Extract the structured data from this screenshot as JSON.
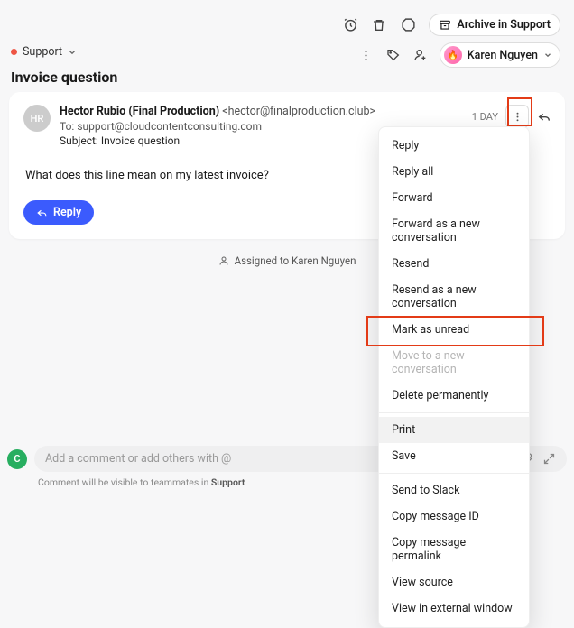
{
  "toolbar": {
    "archive_label": "Archive in Support"
  },
  "breadcrumb": {
    "label": "Support"
  },
  "user": {
    "name": "Karen Nguyen"
  },
  "thread": {
    "title": "Invoice question"
  },
  "message": {
    "sender_initials": "HR",
    "sender_name": "Hector Rubio (Final Production)",
    "sender_email": "<hector@finalproduction.club>",
    "to_label": "To:",
    "to_value": "support@cloudcontentconsulting.com",
    "subject_label": "Subject:",
    "subject_value": "Invoice question",
    "age": "1 DAY",
    "body": "What does this line mean on my latest invoice?",
    "reply_label": "Reply"
  },
  "assigned": {
    "text": "Assigned to Karen Nguyen"
  },
  "menu": {
    "items": [
      {
        "label": "Reply",
        "disabled": false
      },
      {
        "label": "Reply all",
        "disabled": false
      },
      {
        "label": "Forward",
        "disabled": false
      },
      {
        "label": "Forward as a new conversation",
        "disabled": false
      },
      {
        "label": "Resend",
        "disabled": false
      },
      {
        "label": "Resend as a new conversation",
        "disabled": false
      },
      {
        "label": "Mark as unread",
        "disabled": false
      },
      {
        "label": "Move to a new conversation",
        "disabled": true
      },
      {
        "label": "Delete permanently",
        "disabled": false
      }
    ],
    "items2": [
      {
        "label": "Print",
        "hover": true
      },
      {
        "label": "Save"
      }
    ],
    "items3": [
      {
        "label": "Send to Slack"
      },
      {
        "label": "Copy message ID"
      },
      {
        "label": "Copy message permalink"
      },
      {
        "label": "View source"
      },
      {
        "label": "View in external window"
      }
    ]
  },
  "composer": {
    "avatar_initial": "C",
    "placeholder": "Add a comment or add others with @",
    "footer_prefix": "Comment will be visible to teammates in ",
    "footer_bold": "Support"
  }
}
